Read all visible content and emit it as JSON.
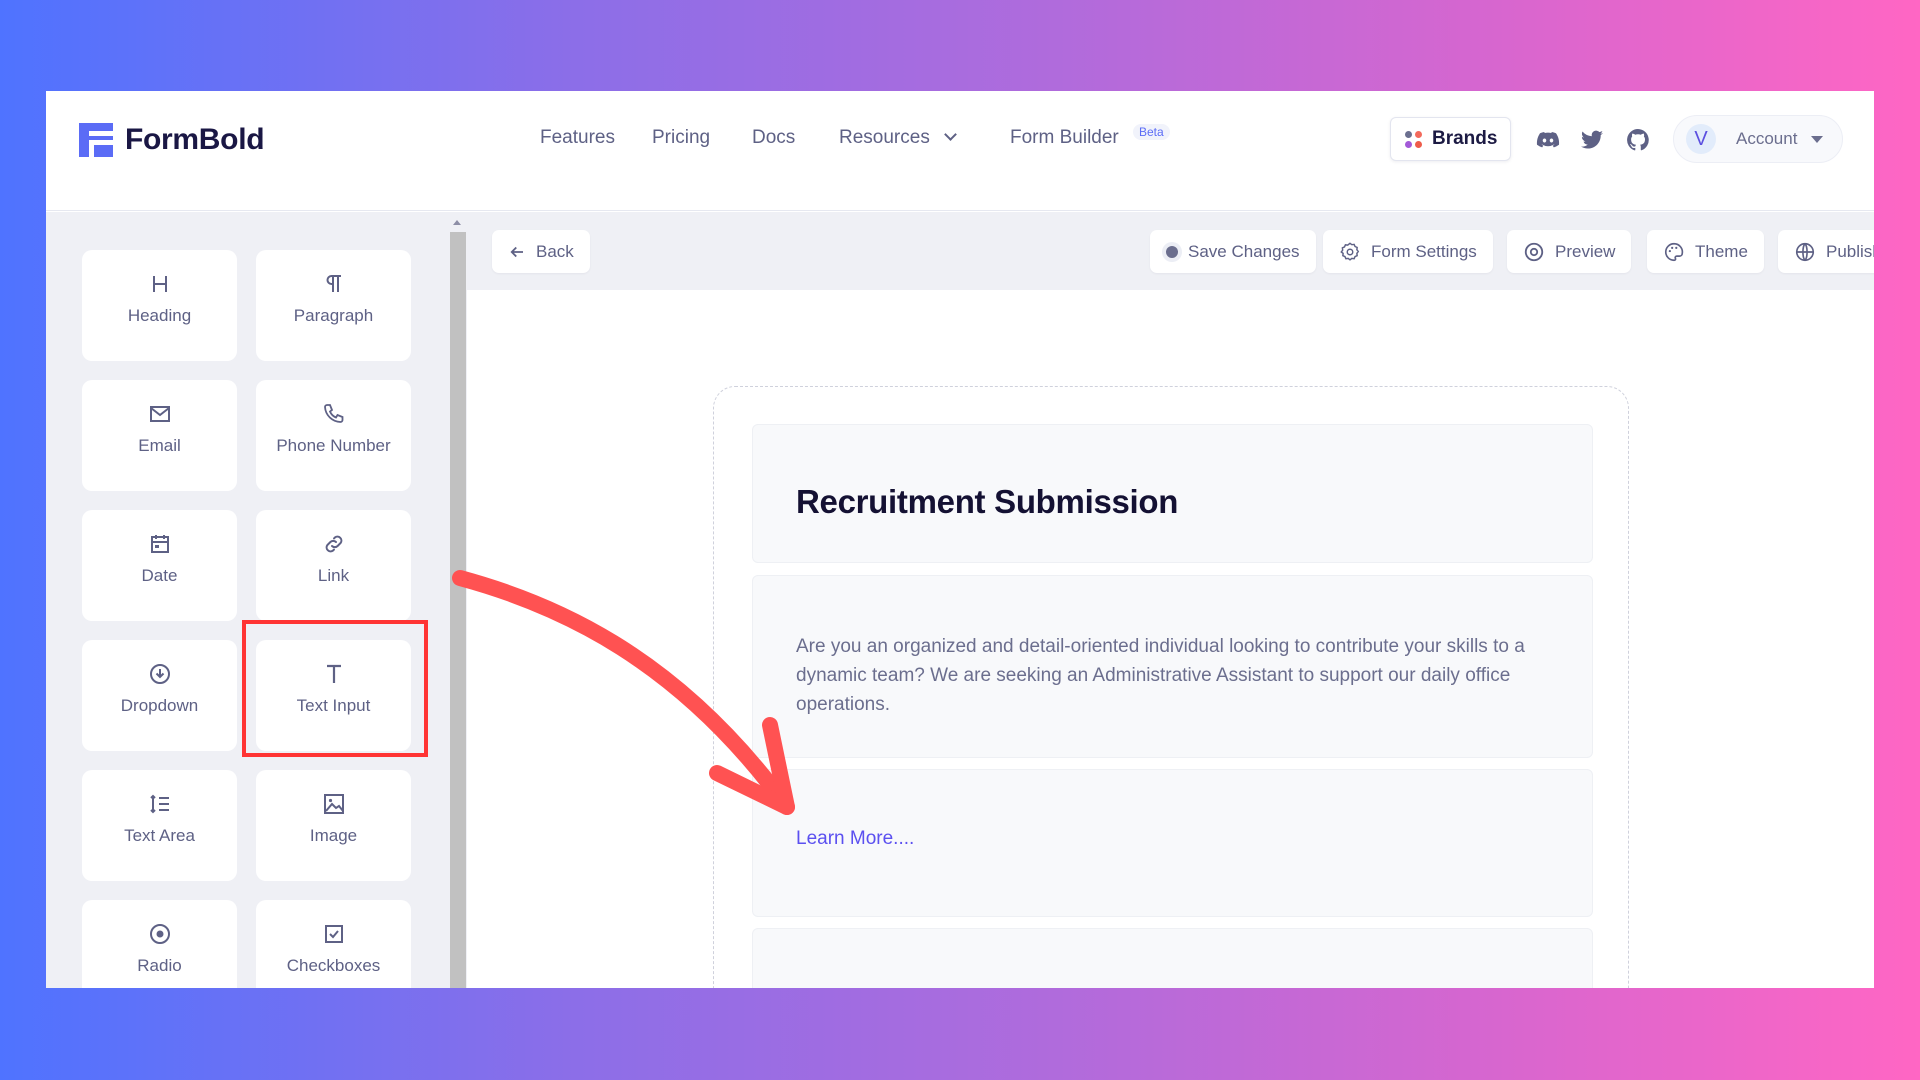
{
  "header": {
    "logo_text": "FormBold",
    "nav": [
      {
        "label": "Features"
      },
      {
        "label": "Pricing"
      },
      {
        "label": "Docs"
      },
      {
        "label": "Resources"
      },
      {
        "label": "Form Builder"
      }
    ],
    "beta_badge": "Beta",
    "brands_label": "Brands",
    "brand_dot_colors": [
      "#6b6f8f",
      "#f36a5c",
      "#a35ad8",
      "#ee5c4b"
    ],
    "social_icons": [
      "discord-icon",
      "twitter-icon",
      "github-icon"
    ],
    "account": {
      "avatar_initial": "V",
      "label": "Account"
    }
  },
  "sidebar": {
    "tiles": [
      {
        "label": "Heading",
        "icon": "heading-icon"
      },
      {
        "label": "Paragraph",
        "icon": "paragraph-icon"
      },
      {
        "label": "Email",
        "icon": "email-icon"
      },
      {
        "label": "Phone Number",
        "icon": "phone-icon"
      },
      {
        "label": "Date",
        "icon": "calendar-icon"
      },
      {
        "label": "Link",
        "icon": "link-icon"
      },
      {
        "label": "Dropdown",
        "icon": "dropdown-icon"
      },
      {
        "label": "Text Input",
        "icon": "text-input-icon"
      },
      {
        "label": "Text Area",
        "icon": "text-area-icon"
      },
      {
        "label": "Image",
        "icon": "image-icon"
      },
      {
        "label": "Radio",
        "icon": "radio-icon"
      },
      {
        "label": "Checkboxes",
        "icon": "checkbox-icon"
      }
    ],
    "highlighted_tile": "Link"
  },
  "toolbar": {
    "back_label": "Back",
    "save_label": "Save Changes",
    "form_settings_label": "Form Settings",
    "preview_label": "Preview",
    "theme_label": "Theme",
    "publish_label": "Publish"
  },
  "form": {
    "title": "Recruitment Submission",
    "paragraph": "Are you an organized and detail-oriented individual looking to contribute your skills to a dynamic team? We are seeking an Administrative Assistant to support our daily office operations.",
    "link_text": "Learn More...."
  },
  "annotation": {
    "highlight_color": "#ff3434",
    "arrow_color": "#ff5252"
  }
}
